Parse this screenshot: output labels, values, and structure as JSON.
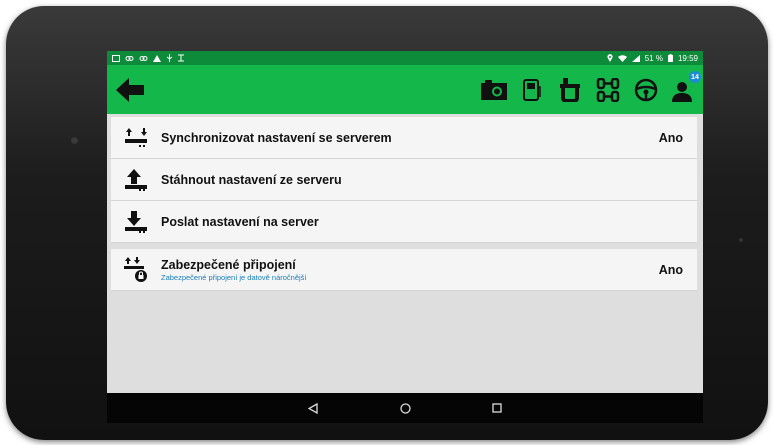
{
  "status_bar": {
    "battery": "51 %",
    "time": "19:59"
  },
  "app_bar": {
    "badge_count": "14"
  },
  "settings": [
    {
      "label": "Synchronizovat nastavení se serverem",
      "value": "Ano",
      "icon": "sync-arrows-icon"
    },
    {
      "label": "Stáhnout nastavení ze serveru",
      "value": "",
      "icon": "upload-arrow-icon"
    },
    {
      "label": "Poslat nastavení na server",
      "value": "",
      "icon": "download-arrow-icon"
    }
  ],
  "secure_connection": {
    "label": "Zabezpečené připojení",
    "subtitle": "Zabezpečené připojení je datově náročnější",
    "value": "Ano",
    "icon": "secure-lock-icon"
  },
  "colors": {
    "app_bar": "#14b84a",
    "status_bar": "#0d8a3a",
    "subtitle": "#1a7fb8",
    "badge": "#1e8ad6"
  }
}
